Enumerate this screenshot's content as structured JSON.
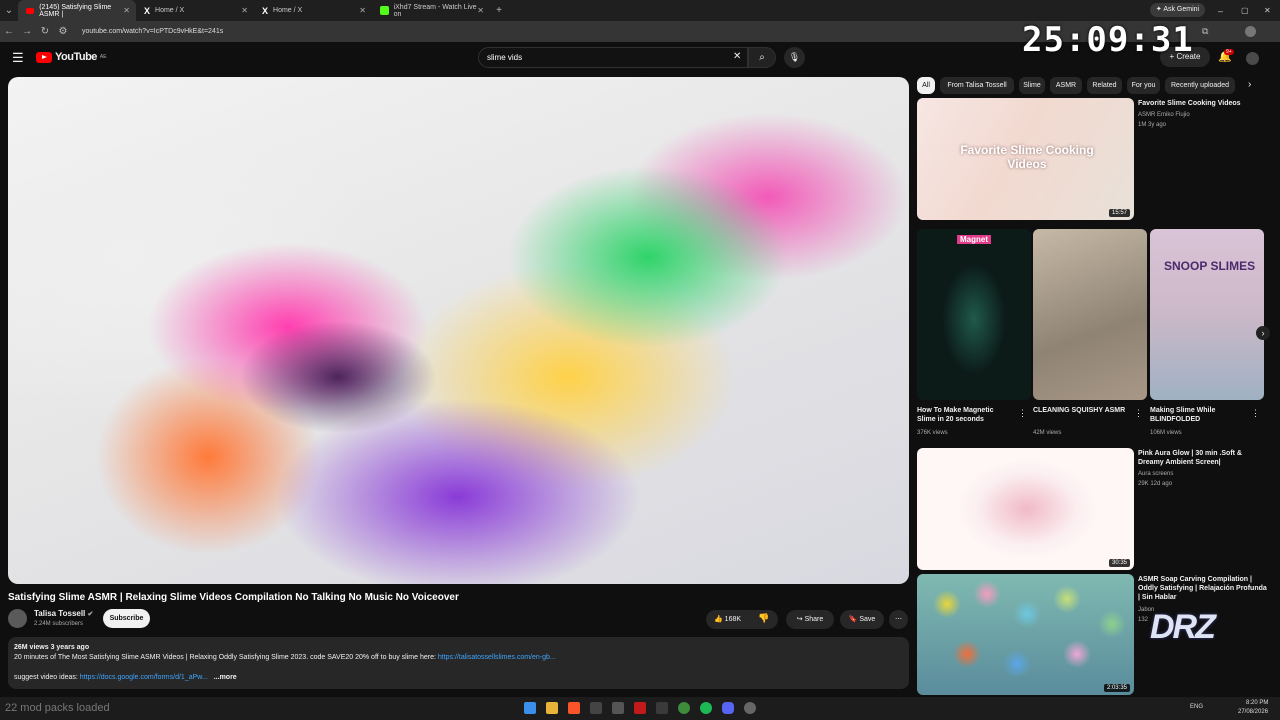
{
  "browser": {
    "tabs": [
      {
        "title": "(2145) Satisfying Slime ASMR |"
      },
      {
        "title": "Home / X"
      },
      {
        "title": "Home / X"
      },
      {
        "title": "iXhd7 Stream - Watch Live on"
      }
    ],
    "url": "youtube.com/watch?v=IcPTDc9vHkE&t=241s",
    "ask_gemini": "Ask Gemini"
  },
  "youtube": {
    "logo": "YouTube",
    "country": "AE",
    "search_value": "slime vids",
    "create_label": "Create",
    "notif_badge": "9+"
  },
  "video": {
    "title": "Satisfying Slime ASMR | Relaxing Slime Videos Compilation No Talking No Music No Voiceover",
    "channel": "Talisa Tossell",
    "subscribers": "2.24M subscribers",
    "subscribe_label": "Subscribe",
    "likes": "168K",
    "share_label": "Share",
    "save_label": "Save",
    "stats": "26M views  3 years ago",
    "desc_line1": "20 minutes of The Most Satisfying Slime ASMR Videos | Relaxing Oddly Satisfying Slime 2023. code SAVE20 20% off to buy  slime here: ",
    "desc_link1": "https://talisatossellslimes.com/en-gb...",
    "desc_line2": "suggest video ideas: ",
    "desc_link2": "https://docs.google.com/forms/d/1_aPw...",
    "more_label": "...more"
  },
  "chips": [
    "All",
    "From Talisa Tossell",
    "Slime",
    "ASMR",
    "Related",
    "For you",
    "Recently uploaded"
  ],
  "recommendations": [
    {
      "title": "Favorite Slime Cooking Videos",
      "channel": "ASMR Emiko Flujio",
      "meta": "1M  3y ago",
      "duration": "15:57",
      "overlay": "Favorite Slime Cooking Videos"
    },
    {
      "title": "Pink Aura Glow | 30 min .Soft & Dreamy Ambient Screen|",
      "channel": "Aura screens",
      "meta": "29K  12d ago",
      "duration": "30:35"
    },
    {
      "title": "ASMR Soap Carving Compilation | Oddly Satisfying | Relajación Profunda | Sin Hablar",
      "channel": "Jabon",
      "meta": "132",
      "duration": "2:03:35"
    }
  ],
  "shorts": [
    {
      "title": "How To Make Magnetic Slime in 20 seconds",
      "views": "376K views",
      "overlay": "Magnet"
    },
    {
      "title": "CLEANING SQUISHY ASMR",
      "views": "42M views"
    },
    {
      "title": "Making Slime While BLINDFOLDED",
      "views": "106M views",
      "overlay": "SNOOP SLIMES"
    }
  ],
  "overlay": {
    "clock": "25:09:31",
    "mods": "22 mod packs loaded",
    "watermark": "DRZ"
  },
  "taskbar": {
    "time": "8:20 PM",
    "date": "27/08/2026",
    "lang": "ENG"
  }
}
